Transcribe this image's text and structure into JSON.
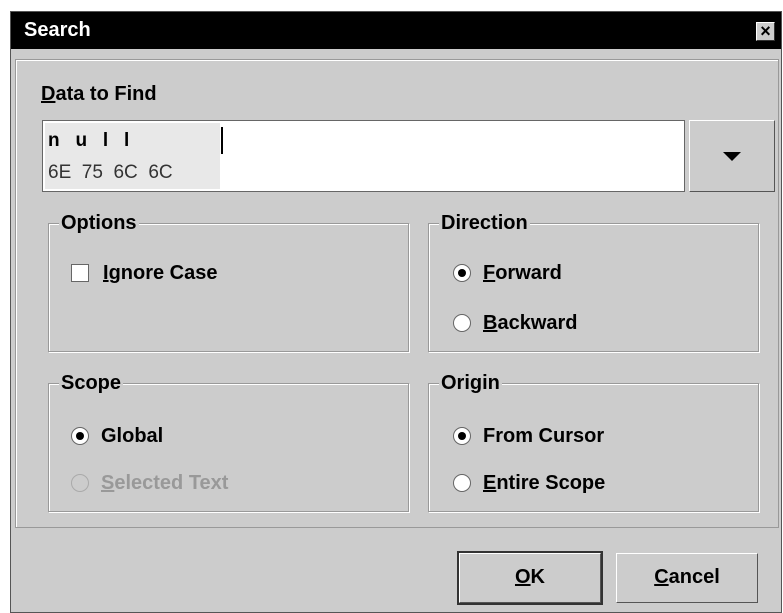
{
  "window": {
    "title": "Search",
    "close_glyph": "×"
  },
  "find": {
    "label_mnemonic": "D",
    "label_rest": "ata to Find",
    "chars": "n   u   l   l",
    "hex": "6E  75  6C  6C",
    "dropdown_icon": "triangle-down"
  },
  "options": {
    "title": "Options",
    "ignore_case_mnemonic": "I",
    "ignore_case_rest": "gnore Case",
    "ignore_case_checked": false
  },
  "direction": {
    "title": "Direction",
    "forward_mnemonic": "F",
    "forward_rest": "orward",
    "backward_mnemonic": "B",
    "backward_rest": "ackward",
    "selected": "forward"
  },
  "scope": {
    "title": "Scope",
    "global_label": "Global",
    "selected_text_mnemonic": "S",
    "selected_text_rest": "elected Text",
    "selected": "global"
  },
  "origin": {
    "title": "Origin",
    "from_cursor_label": "From Cursor",
    "entire_scope_mnemonic": "E",
    "entire_scope_rest": "ntire Scope",
    "selected": "from_cursor"
  },
  "buttons": {
    "ok_mnemonic": "O",
    "ok_rest": "K",
    "cancel_mnemonic": "C",
    "cancel_rest": "ancel"
  }
}
